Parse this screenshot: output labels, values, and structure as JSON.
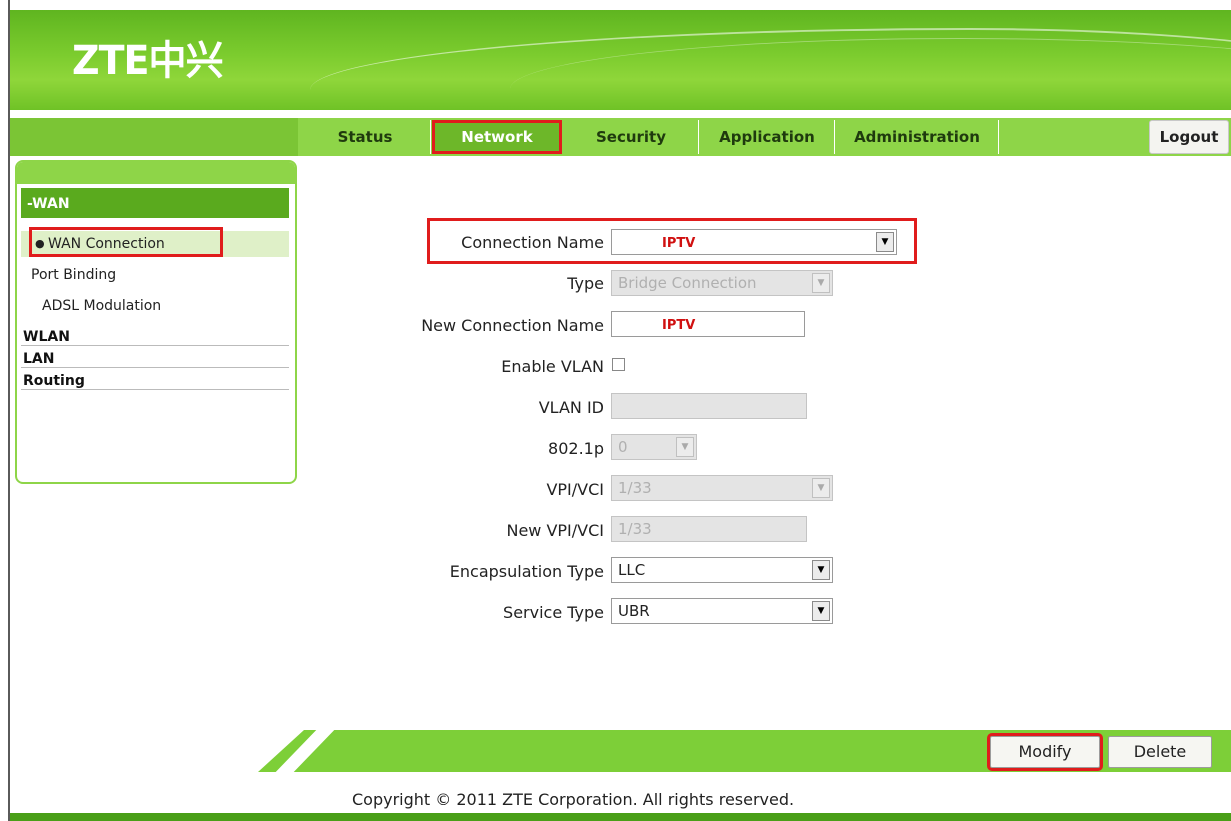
{
  "brand": {
    "logo_text": "ZTE中兴",
    "accent": "#7dcf38",
    "highlight": "#e01c1c"
  },
  "nav": {
    "tabs": [
      "Status",
      "Network",
      "Security",
      "Application",
      "Administration"
    ],
    "active": "Network",
    "logout": "Logout"
  },
  "sidebar": {
    "section_wan": "-WAN",
    "wan_items": [
      "WAN Connection",
      "Port Binding",
      "ADSL Modulation"
    ],
    "active_item": "WAN Connection",
    "sections": [
      "WLAN",
      "LAN",
      "Routing"
    ]
  },
  "form": {
    "connection_name": {
      "label": "Connection Name",
      "value": "IPTV"
    },
    "type": {
      "label": "Type",
      "value": "Bridge Connection"
    },
    "new_connection_name": {
      "label": "New Connection Name",
      "value": "IPTV"
    },
    "enable_vlan": {
      "label": "Enable VLAN",
      "checked": false
    },
    "vlan_id": {
      "label": "VLAN ID",
      "value": ""
    },
    "p8021": {
      "label": "802.1p",
      "value": "0"
    },
    "vpi_vci": {
      "label": "VPI/VCI",
      "value": "1/33"
    },
    "new_vpi_vci": {
      "label": "New VPI/VCI",
      "value": "1/33"
    },
    "encapsulation": {
      "label": "Encapsulation Type",
      "value": "LLC"
    },
    "service_type": {
      "label": "Service Type",
      "value": "UBR"
    }
  },
  "actions": {
    "modify": "Modify",
    "delete": "Delete"
  },
  "footer": {
    "copyright": "Copyright © 2011 ZTE Corporation. All rights reserved."
  }
}
